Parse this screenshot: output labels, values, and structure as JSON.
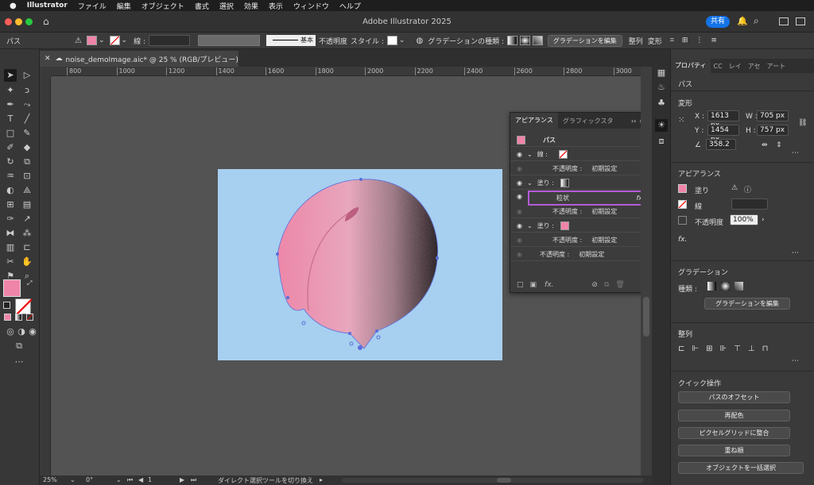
{
  "menubar": {
    "apple": "",
    "app": "Illustrator",
    "items": [
      "ファイル",
      "編集",
      "オブジェクト",
      "書式",
      "選択",
      "効果",
      "表示",
      "ウィンドウ",
      "ヘルプ"
    ]
  },
  "titlebar": {
    "title": "Adobe Illustrator 2025",
    "share": "共有"
  },
  "control": {
    "selection": "パス",
    "stroke_label": "線 :",
    "brush": "基本",
    "opacity": "不透明度",
    "style": "スタイル :",
    "gradient_type": "グラデーションの種類 :",
    "edit_gradient": "グラデーションを編集",
    "align": "整列",
    "transform": "変形"
  },
  "document": {
    "tab": "noise_demoImage.aic* @ 25 % (RGB/プレビュー)"
  },
  "ruler": {
    "ticks": [
      "800",
      "1000",
      "1200",
      "1400",
      "1600",
      "1800",
      "2000",
      "2200",
      "2400",
      "2600",
      "2800",
      "3000"
    ]
  },
  "status": {
    "zoom": "25%",
    "rotate": "0°",
    "artboard": "1",
    "message": "ダイレクト選択ツールを切り換え"
  },
  "appearance_panel": {
    "tabs": [
      "アピアランス",
      "グラフィックスタ"
    ],
    "title": "パス",
    "rows": {
      "stroke": "線 :",
      "opacity1": "不透明度 :",
      "default1": "初期設定",
      "fill1": "塗り :",
      "grain": "粒状",
      "fx": "fx",
      "opacity2": "不透明度 :",
      "default2": "初期設定",
      "fill2": "塗り :",
      "opacity3": "不透明度 :",
      "default3": "初期設定",
      "opacity4": "不透明度 :",
      "default4": "初期設定"
    }
  },
  "properties": {
    "tabs": [
      "プロパティ",
      "CC",
      "レイ",
      "アセ",
      "アート"
    ],
    "kind": "パス",
    "transform": "変形",
    "x_label": "X :",
    "x": "1613 px",
    "y_label": "Y :",
    "y": "1454 px",
    "w_label": "W :",
    "w": "705 px",
    "h_label": "H :",
    "h": "757 px",
    "angle": "358.2",
    "appearance": "アピアランス",
    "fill": "塗り",
    "stroke": "線",
    "opacity": "不透明度",
    "opacity_val": "100%",
    "fx": "fx.",
    "gradient": "グラデーション",
    "type": "種類 :",
    "edit_gradient": "グラデーションを編集",
    "align": "整列",
    "quick": "クイック操作",
    "offset_path": "パスのオフセット",
    "recolor": "再配色",
    "pixel_grid": "ピクセルグリッドに整合",
    "arrange": "重ね順",
    "batch": "オブジェクトを一括選択"
  },
  "colors": {
    "pink": "#ef85a8",
    "accent": "#b45bd9",
    "artboard": "#a7cff0"
  }
}
